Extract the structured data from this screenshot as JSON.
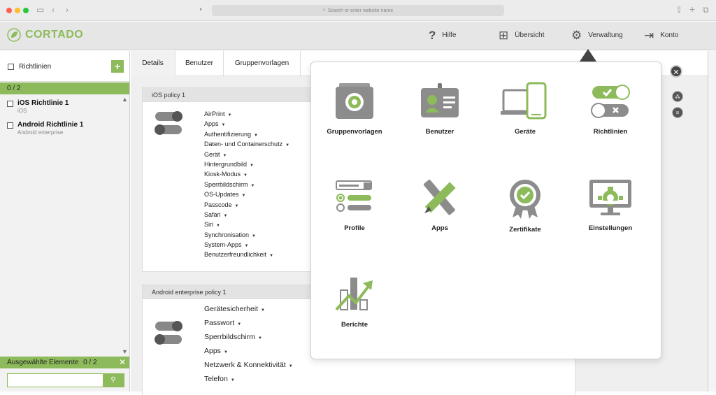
{
  "browser": {
    "url_placeholder": "Search or enter website name"
  },
  "app": {
    "logo": "CORTADO",
    "nav": [
      {
        "label": "Hilfe",
        "icon": "question-icon"
      },
      {
        "label": "Übersicht",
        "icon": "grid-icon"
      },
      {
        "label": "Verwaltung",
        "icon": "gear-icon"
      },
      {
        "label": "Konto",
        "icon": "logout-icon"
      }
    ]
  },
  "sidebar": {
    "header": "Richtlinien",
    "count": "0 / 2",
    "items": [
      {
        "title": "iOS Richtlinie 1",
        "subtitle": "iOS"
      },
      {
        "title": "Android Richtlinie 1",
        "subtitle": "Android enterprise"
      }
    ],
    "selected_label": "Ausgewählte Elemente",
    "selected_count": "0 / 2",
    "search_value": ""
  },
  "tabs": [
    {
      "label": "Details"
    },
    {
      "label": "Benutzer"
    },
    {
      "label": "Gruppenvorlagen"
    }
  ],
  "cards": {
    "ios": {
      "title": "iOS policy 1",
      "items": [
        "AirPrint",
        "Apps",
        "Authentifizierung",
        "Daten- und Containerschutz",
        "Gerät",
        "Hintergrundbild",
        "Kiosk-Modus",
        "Sperrbildschirm",
        "OS-Updates",
        "Passcode",
        "Safari",
        "Siri",
        "Synchronisation",
        "System-Apps",
        "Benutzerfreundlichkeit"
      ]
    },
    "android": {
      "title": "Android enterprise policy 1",
      "items": [
        "Gerätesicherheit",
        "Passwort",
        "Sperrbildschirm",
        "Apps",
        "Netzwerk & Konnektivität",
        "Telefon"
      ]
    }
  },
  "menu": {
    "tiles": [
      {
        "label": "Gruppenvorlagen",
        "icon": "group-template-icon"
      },
      {
        "label": "Benutzer",
        "icon": "user-badge-icon"
      },
      {
        "label": "Geräte",
        "icon": "devices-icon"
      },
      {
        "label": "Richtlinien",
        "icon": "policy-toggle-icon"
      },
      {
        "label": "Profile",
        "icon": "profile-icon"
      },
      {
        "label": "Apps",
        "icon": "apps-tools-icon"
      },
      {
        "label": "Zertifikate",
        "icon": "certificate-icon"
      },
      {
        "label": "Einstellungen",
        "icon": "settings-monitor-icon"
      },
      {
        "label": "Berichte",
        "icon": "reports-chart-icon"
      }
    ]
  },
  "colors": {
    "accent": "#8dbb5b",
    "dark": "#444444"
  }
}
